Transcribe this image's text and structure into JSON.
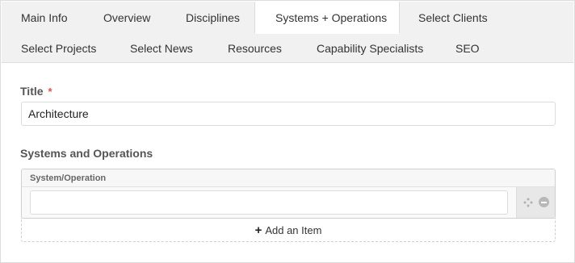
{
  "tabs": [
    {
      "label": "Main Info"
    },
    {
      "label": "Overview"
    },
    {
      "label": "Disciplines"
    },
    {
      "label": "Systems + Operations",
      "active": true
    },
    {
      "label": "Select Clients"
    },
    {
      "label": "Select Projects"
    },
    {
      "label": "Select News"
    },
    {
      "label": "Resources"
    },
    {
      "label": "Capability Specialists"
    },
    {
      "label": "SEO"
    }
  ],
  "form": {
    "title_label": "Title",
    "required_marker": "*",
    "title_value": "Architecture",
    "systems_label": "Systems and Operations",
    "repeater": {
      "column_header": "System/Operation",
      "row_value": ""
    },
    "add_item_label": "Add an Item",
    "add_item_icon": "+"
  },
  "colors": {
    "tab_bar_bg": "#f1f1f1",
    "required": "#d9534f",
    "border": "#dcdcdc"
  }
}
